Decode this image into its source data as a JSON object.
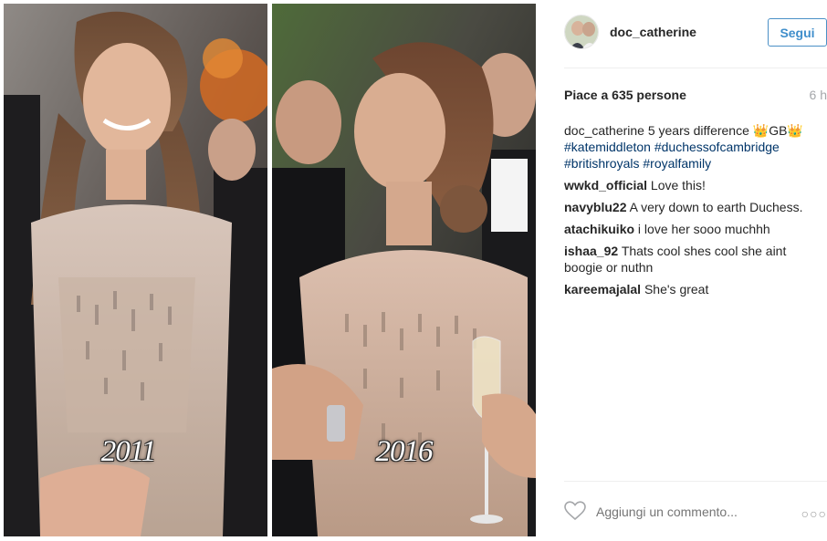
{
  "post": {
    "image": {
      "left_year": "2011",
      "right_year": "2016"
    },
    "header": {
      "username": "doc_catherine",
      "follow_label": "Segui"
    },
    "likes_text": "Piace a 635 persone",
    "time_ago": "6 h",
    "caption": {
      "user": "doc_catherine",
      "text": "5 years difference",
      "emoji": "👑GB👑",
      "hashtags": [
        "#katemiddleton",
        "#duchessofcambridge",
        "#britishroyals",
        "#royalfamily"
      ]
    },
    "comments": [
      {
        "user": "wwkd_official",
        "text": "Love this!"
      },
      {
        "user": "navyblu22",
        "text": "A very down to earth Duchess."
      },
      {
        "user": "atachikuiko",
        "text": "i love her sooo muchhh"
      },
      {
        "user": "ishaa_92",
        "text": "Thats cool shes cool she aint boogie or nuthn"
      },
      {
        "user": "kareemajalal",
        "text": "She's great"
      }
    ],
    "footer": {
      "comment_placeholder": "Aggiungi un commento...",
      "more_label": "○○○"
    },
    "colors": {
      "link": "#003569",
      "follow_blue": "#3f8ecb",
      "muted": "#a5a7aa"
    }
  }
}
